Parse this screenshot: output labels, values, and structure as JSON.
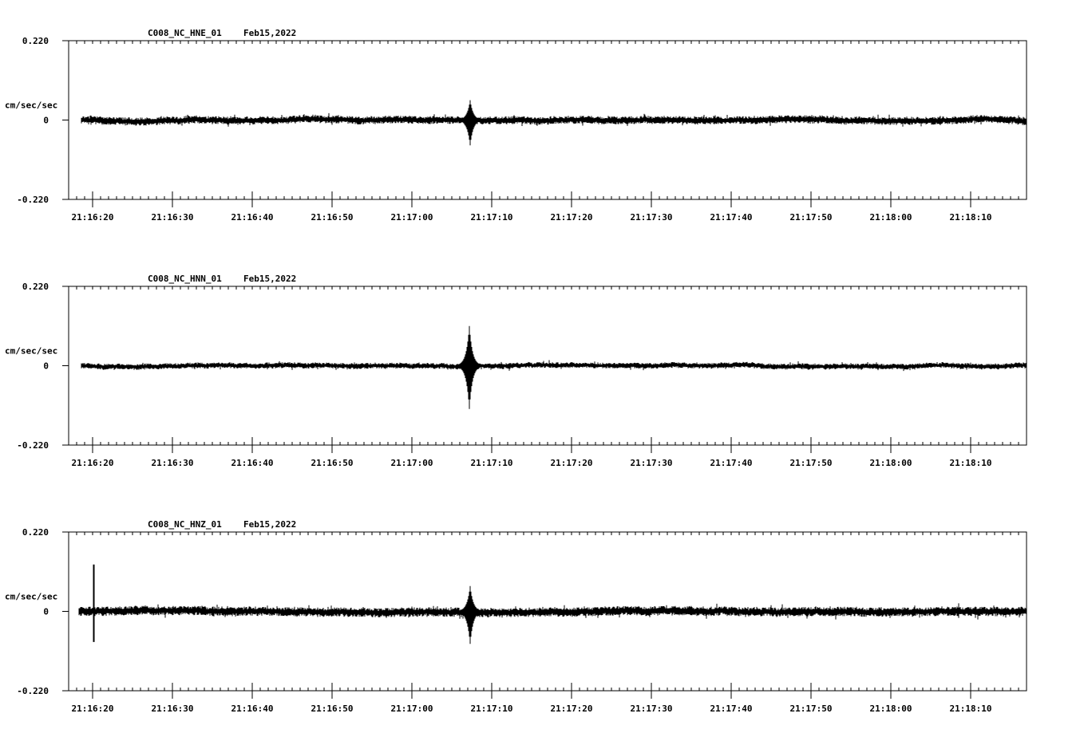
{
  "chart_data": [
    {
      "type": "line",
      "title": "C008_NC_HNE_01",
      "date": "Feb15,2022",
      "ylabel": "cm/sec/sec",
      "ylim": [
        -0.22,
        0.22
      ],
      "y_tick_labels": [
        "0.220",
        "0",
        "-0.220"
      ],
      "x_tick_labels": [
        "21:16:20",
        "21:16:30",
        "21:16:40",
        "21:16:50",
        "21:17:00",
        "21:17:10",
        "21:17:20",
        "21:17:30",
        "21:17:40",
        "21:17:50",
        "21:18:00",
        "21:18:10"
      ],
      "x_range_seconds_after_21_16_00": [
        17,
        137
      ],
      "trace": {
        "start_second": 18.6,
        "noise_amplitude": 0.011,
        "event": {
          "time_second": 67.3,
          "peak_positive": 0.055,
          "peak_negative": -0.07
        },
        "color": "#000000"
      }
    },
    {
      "type": "line",
      "title": "C008_NC_HNN_01",
      "date": "Feb15,2022",
      "ylabel": "cm/sec/sec",
      "ylim": [
        -0.22,
        0.22
      ],
      "y_tick_labels": [
        "0.220",
        "0",
        "-0.220"
      ],
      "x_tick_labels": [
        "21:16:20",
        "21:16:30",
        "21:16:40",
        "21:16:50",
        "21:17:00",
        "21:17:10",
        "21:17:20",
        "21:17:30",
        "21:17:40",
        "21:17:50",
        "21:18:00",
        "21:18:10"
      ],
      "x_range_seconds_after_21_16_00": [
        17,
        137
      ],
      "trace": {
        "start_second": 18.6,
        "noise_amplitude": 0.008,
        "event": {
          "time_second": 67.2,
          "peak_positive": 0.11,
          "peak_negative": -0.12
        },
        "color": "#000000"
      }
    },
    {
      "type": "line",
      "title": "C008_NC_HNZ_01",
      "date": "Feb15,2022",
      "ylabel": "cm/sec/sec",
      "ylim": [
        -0.22,
        0.22
      ],
      "y_tick_labels": [
        "0.220",
        "0",
        "-0.220"
      ],
      "x_tick_labels": [
        "21:16:20",
        "21:16:30",
        "21:16:40",
        "21:16:50",
        "21:17:00",
        "21:17:10",
        "21:17:20",
        "21:17:30",
        "21:17:40",
        "21:17:50",
        "21:18:00",
        "21:18:10"
      ],
      "x_range_seconds_after_21_16_00": [
        17,
        137
      ],
      "trace": {
        "start_second": 18.3,
        "noise_amplitude": 0.013,
        "event": {
          "time_second": 67.3,
          "peak_positive": 0.07,
          "peak_negative": -0.09
        },
        "spike": {
          "time_second": 20.1,
          "peak_positive": 0.13,
          "peak_negative": -0.085
        },
        "color": "#000000"
      }
    }
  ]
}
